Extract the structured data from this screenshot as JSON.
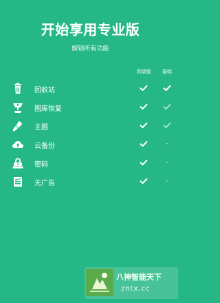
{
  "header": {
    "title": "开始享用专业版",
    "subtitle": "解锁所有功能"
  },
  "columns": {
    "pro": "高级版",
    "basic": "基础"
  },
  "features": [
    {
      "label": "回收站",
      "icon": "trash-icon",
      "pro": true,
      "basic": true,
      "basic_muted": false
    },
    {
      "label": "图库恢复",
      "icon": "gallery-restore-icon",
      "pro": true,
      "basic": true,
      "basic_muted": true
    },
    {
      "label": "主题",
      "icon": "brush-icon",
      "pro": true,
      "basic": true,
      "basic_muted": true
    },
    {
      "label": "云备份",
      "icon": "cloud-upload-icon",
      "pro": true,
      "basic": false,
      "basic_muted": false
    },
    {
      "label": "密码",
      "icon": "lock-icon",
      "pro": true,
      "basic": false,
      "basic_muted": false
    },
    {
      "label": "无广告",
      "icon": "no-ads-icon",
      "pro": true,
      "basic": false,
      "basic_muted": false
    }
  ],
  "dash": "-",
  "watermark": {
    "title": "八神智能天下",
    "subtitle": "zntx.cc"
  },
  "colors": {
    "background": "#25b886",
    "text": "#ffffff"
  }
}
